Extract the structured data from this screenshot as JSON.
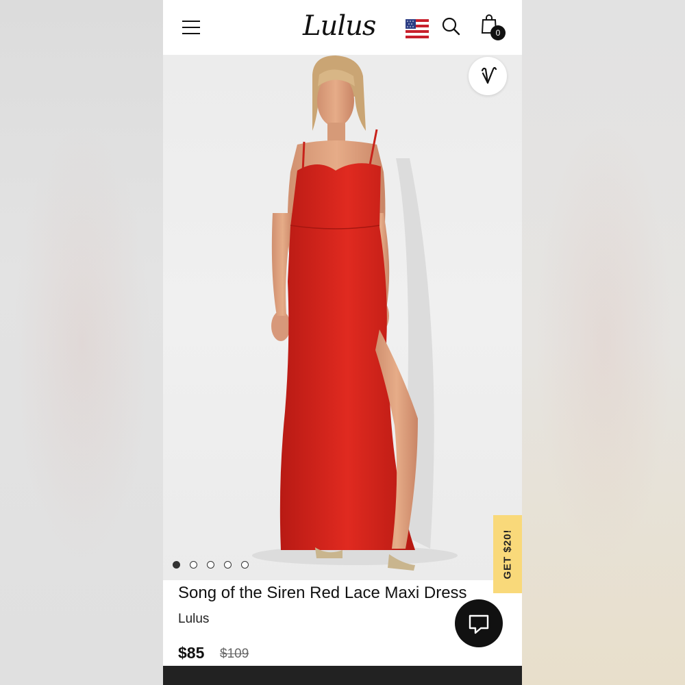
{
  "header": {
    "logo_text": "Lulus",
    "menu_icon": "hamburger-menu-icon",
    "flag_icon": "us-flag-icon",
    "search_icon": "search-icon",
    "bag_icon": "shopping-bag-icon",
    "bag_count": "0"
  },
  "product": {
    "title": "Song of the Siren Red Lace Maxi Dress",
    "brand": "Lulus",
    "price": "$85",
    "original_price": "$109",
    "image_count": 5,
    "active_image_index": 0,
    "dress_color": "#d8241c"
  },
  "promo": {
    "label": "GET $20!",
    "color": "#f9d97a"
  },
  "wishlist_icon": "heart-icon",
  "chat_icon": "chat-bubble-icon"
}
